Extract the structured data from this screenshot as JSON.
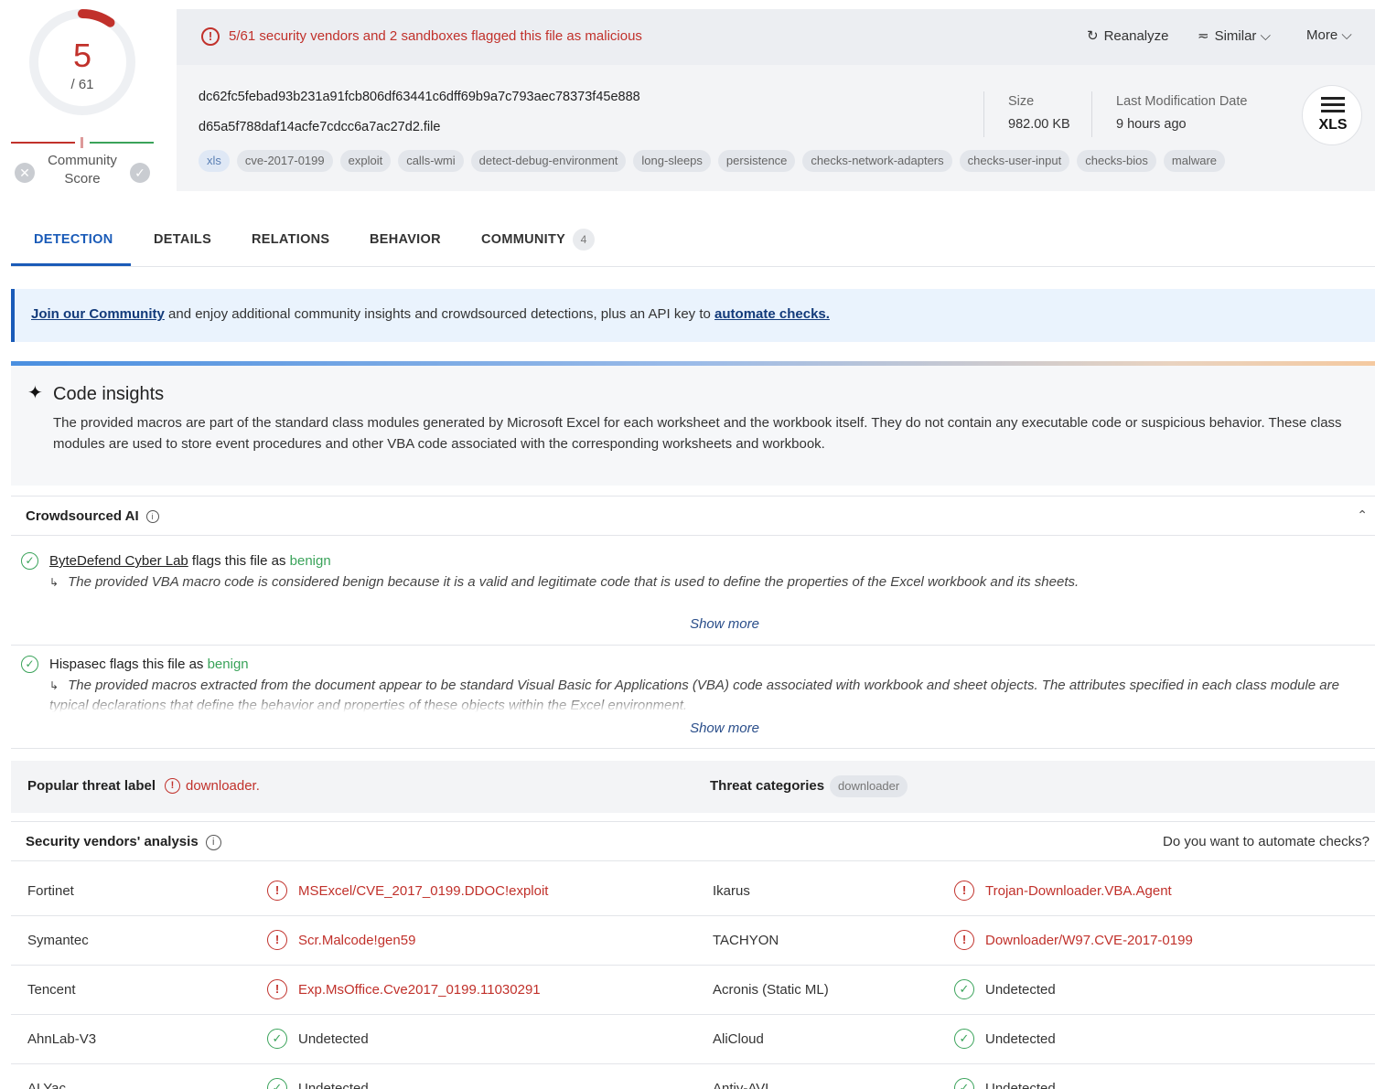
{
  "score": {
    "detected": "5",
    "total": "/ 61",
    "community_label_1": "Community",
    "community_label_2": "Score"
  },
  "alert": {
    "text": "5/61 security vendors and 2 sandboxes flagged this file as malicious"
  },
  "actions": {
    "reanalyze": "Reanalyze",
    "similar": "Similar",
    "more": "More"
  },
  "file": {
    "hash": "dc62fc5febad93b231a91fcb806df63441c6dff69b9a7c793aec78373f45e888",
    "name": "d65a5f788daf14acfe7cdcc6a7ac27d2.file",
    "size_label": "Size",
    "size_value": "982.00 KB",
    "date_label": "Last Modification Date",
    "date_value": "9 hours ago",
    "type_badge": "XLS"
  },
  "tags": [
    "xls",
    "cve-2017-0199",
    "exploit",
    "calls-wmi",
    "detect-debug-environment",
    "long-sleeps",
    "persistence",
    "checks-network-adapters",
    "checks-user-input",
    "checks-bios",
    "malware"
  ],
  "tabs": {
    "detection": "DETECTION",
    "details": "DETAILS",
    "relations": "RELATIONS",
    "behavior": "BEHAVIOR",
    "community": "COMMUNITY",
    "community_count": "4"
  },
  "banner": {
    "join_link": "Join our Community",
    "middle": " and enjoy additional community insights and crowdsourced detections, plus an API key to ",
    "automate_link": "automate checks."
  },
  "insights": {
    "title": "Code insights",
    "body": "The provided macros are part of the standard class modules generated by Microsoft Excel for each worksheet and the workbook itself. They do not contain any executable code or suspicious behavior. These class modules are used to store event procedures and other VBA code associated with the corresponding worksheets and workbook."
  },
  "crowd": {
    "title": "Crowdsourced AI",
    "show_more": "Show more",
    "items": [
      {
        "source": "ByteDefend Cyber Lab",
        "flag_text": " flags this file as ",
        "verdict": "benign",
        "desc": "The provided VBA macro code is considered benign because it is a valid and legitimate code that is used to define the properties of the Excel workbook and its sheets."
      },
      {
        "source": "Hispasec",
        "flag_text": " flags this file as ",
        "verdict": "benign",
        "desc": "The provided macros extracted from the document appear to be standard Visual Basic for Applications (VBA) code associated with workbook and sheet objects. The attributes specified in each class module are typical declarations that define the behavior and properties of these objects within the Excel environment."
      }
    ]
  },
  "threat": {
    "popular_label": "Popular threat label",
    "popular_value": "downloader.",
    "categories_label": "Threat categories",
    "category": "downloader"
  },
  "vendors": {
    "title": "Security vendors' analysis",
    "automate": "Do you want to automate checks?",
    "rows": [
      {
        "left_name": "Fortinet",
        "left_result": "MSExcel/CVE_2017_0199.DDOC!exploit",
        "right_name": "Ikarus",
        "right_result": "Trojan-Downloader.VBA.Agent"
      },
      {
        "left_name": "Symantec",
        "left_result": "Scr.Malcode!gen59",
        "right_name": "TACHYON",
        "right_result": "Downloader/W97.CVE-2017-0199"
      },
      {
        "left_name": "Tencent",
        "left_result": "Exp.MsOffice.Cve2017_0199.11030291",
        "right_name": "Acronis (Static ML)",
        "right_result": "Undetected"
      },
      {
        "left_name": "AhnLab-V3",
        "left_result": "Undetected",
        "right_name": "AliCloud",
        "right_result": "Undetected"
      },
      {
        "left_name": "ALYac",
        "left_result": "Undetected",
        "right_name": "Antiy-AVL",
        "right_result": "Undetected"
      }
    ]
  },
  "colors": {
    "malicious": "#c1312b",
    "benign": "#3aa35a",
    "accent": "#1a5bb8"
  }
}
